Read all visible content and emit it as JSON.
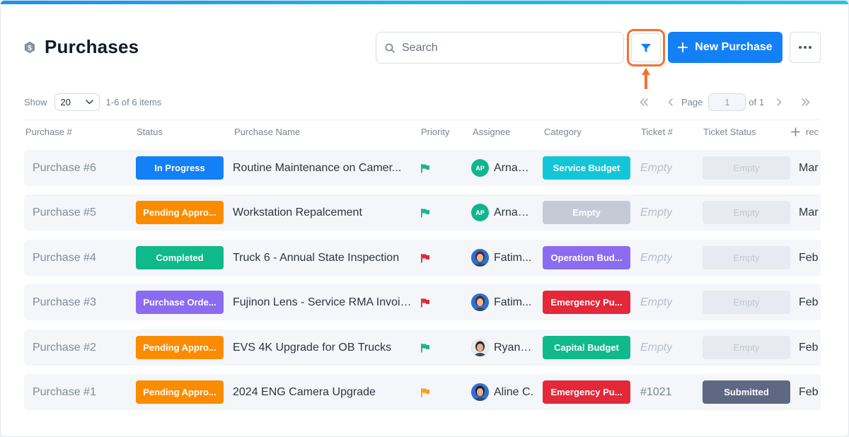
{
  "header": {
    "title": "Purchases",
    "search_placeholder": "Search",
    "new_button_label": "New Purchase"
  },
  "toolbar": {
    "show_label": "Show",
    "page_size": "20",
    "items_count": "1-6 of 6 items",
    "page_label": "Page",
    "current_page": "1",
    "of_pages": "of 1"
  },
  "columns": [
    "Purchase #",
    "Status",
    "Purchase Name",
    "Priority",
    "Assignee",
    "Category",
    "Ticket #",
    "Ticket Status",
    "rec"
  ],
  "colors": {
    "accent": "#1380f6",
    "highlight": "#f27232",
    "in_progress": "#1380f6",
    "pending": "#fb8c00",
    "completed": "#10b98a",
    "purchase_order": "#8b6cf0",
    "service_budget": "#12c6d8",
    "empty_category": "#c5cad6",
    "operation_budget": "#8b6cf0",
    "emergency": "#e3283a",
    "capital_budget": "#10b98a",
    "flag_green": "#14b78c",
    "flag_red": "#e3283a",
    "flag_orange": "#f7a21b"
  },
  "rows": [
    {
      "number": "Purchase #6",
      "status": "In Progress",
      "status_color": "#1380f6",
      "name": "Routine Maintenance on Camer...",
      "priority_color": "#14b78c",
      "assignee": "Arnav ...",
      "avatar_initials": "AP",
      "avatar_type": "initials",
      "category": "Service Budget",
      "category_color": "#12c6d8",
      "ticket": "Empty",
      "ticket_status": "Empty",
      "extra": "Mar"
    },
    {
      "number": "Purchase #5",
      "status": "Pending Appro...",
      "status_color": "#fb8c00",
      "name": "Workstation Repalcement",
      "priority_color": "#14b78c",
      "assignee": "Arnav ...",
      "avatar_initials": "AP",
      "avatar_type": "initials",
      "category": "Empty",
      "category_color": "#c5cad6",
      "ticket": "Empty",
      "ticket_status": "Empty",
      "extra": "Mar"
    },
    {
      "number": "Purchase #4",
      "status": "Completed",
      "status_color": "#10b98a",
      "name": "Truck 6 - Annual State Inspection",
      "priority_color": "#e3283a",
      "assignee": "Fatim...",
      "avatar_initials": "",
      "avatar_type": "photo-f",
      "category": "Operation Bud...",
      "category_color": "#8b6cf0",
      "ticket": "Empty",
      "ticket_status": "Empty",
      "extra": "Feb"
    },
    {
      "number": "Purchase #3",
      "status": "Purchase Orde...",
      "status_color": "#8b6cf0",
      "name": "Fujinon Lens - Service RMA Invoice",
      "priority_color": "#e3283a",
      "assignee": "Fatim...",
      "avatar_initials": "",
      "avatar_type": "photo-f",
      "category": "Emergency Pu...",
      "category_color": "#e3283a",
      "ticket": "Empty",
      "ticket_status": "Empty",
      "extra": "Feb"
    },
    {
      "number": "Purchase #2",
      "status": "Pending Appro...",
      "status_color": "#fb8c00",
      "name": "EVS 4K Upgrade for OB Trucks",
      "priority_color": "#14b78c",
      "assignee": "Ryan D.",
      "avatar_initials": "",
      "avatar_type": "photo-r",
      "category": "Capital Budget",
      "category_color": "#10b98a",
      "ticket": "Empty",
      "ticket_status": "Empty",
      "extra": "Feb"
    },
    {
      "number": "Purchase #1",
      "status": "Pending Appro...",
      "status_color": "#fb8c00",
      "name": "2024 ENG Camera Upgrade",
      "priority_color": "#f7a21b",
      "assignee": "Aline C.",
      "avatar_initials": "",
      "avatar_type": "photo-a",
      "category": "Emergency Pu...",
      "category_color": "#e3283a",
      "ticket": "#1021",
      "ticket_status": "Submitted",
      "extra": "Feb"
    }
  ]
}
